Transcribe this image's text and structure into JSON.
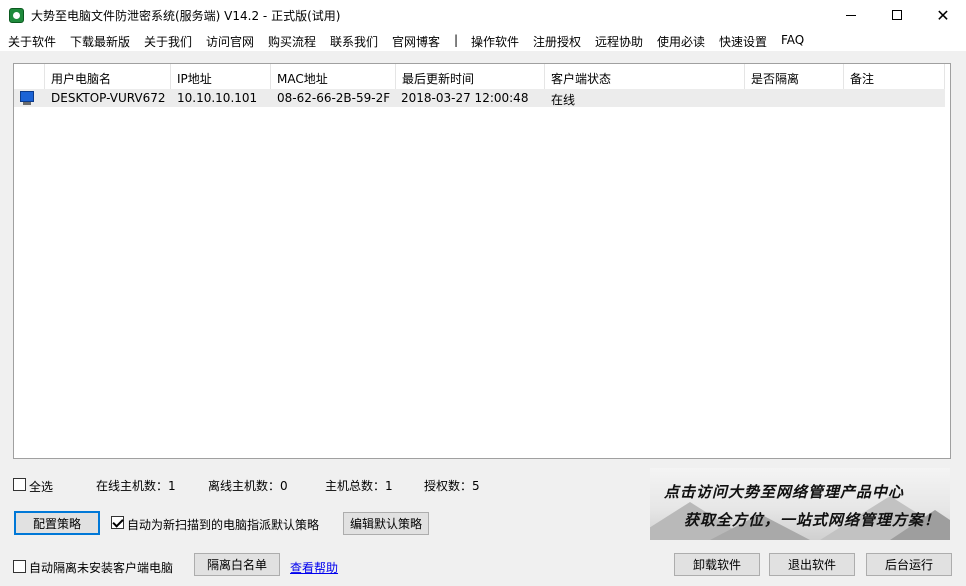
{
  "window": {
    "title": "大势至电脑文件防泄密系统(服务端) V14.2 - 正式版(试用)"
  },
  "menu": [
    "关于软件",
    "下载最新版",
    "关于我们",
    "访问官网",
    "购买流程",
    "联系我们",
    "官网博客",
    "操作软件",
    "注册授权",
    "远程协助",
    "使用必读",
    "快速设置",
    "FAQ"
  ],
  "menu_separator": "|",
  "table": {
    "columns": [
      "用户电脑名",
      "IP地址",
      "MAC地址",
      "最后更新时间",
      "客户端状态",
      "是否隔离",
      "备注"
    ],
    "rows": [
      {
        "name": "DESKTOP-VURV672",
        "ip": "10.10.10.101",
        "mac": "08-62-66-2B-59-2F",
        "updated": "2018-03-27 12:00:48",
        "status": "在线",
        "isolated": "",
        "note": ""
      }
    ]
  },
  "stats": {
    "select_all": "全选",
    "online": "在线主机数：1",
    "offline": "离线主机数：0",
    "total": "主机总数：1",
    "licensed": "授权数：5"
  },
  "controls": {
    "config_policy": "配置策略",
    "auto_assign": "自动为新扫描到的电脑指派默认策略",
    "auto_assign_checked": true,
    "edit_default": "编辑默认策略",
    "auto_isolate": "自动隔离未安装客户端电脑",
    "auto_isolate_checked": false,
    "whitelist": "隔离白名单",
    "help": "查看帮助",
    "uninstall": "卸载软件",
    "exit": "退出软件",
    "background": "后台运行"
  },
  "banner": {
    "line1": "点击访问大势至网络管理产品中心",
    "line2": "获取全方位，一站式网络管理方案！"
  },
  "colors": {
    "accent": "#0078d7",
    "link": "#0000ee",
    "selected_row": "#ececec"
  }
}
